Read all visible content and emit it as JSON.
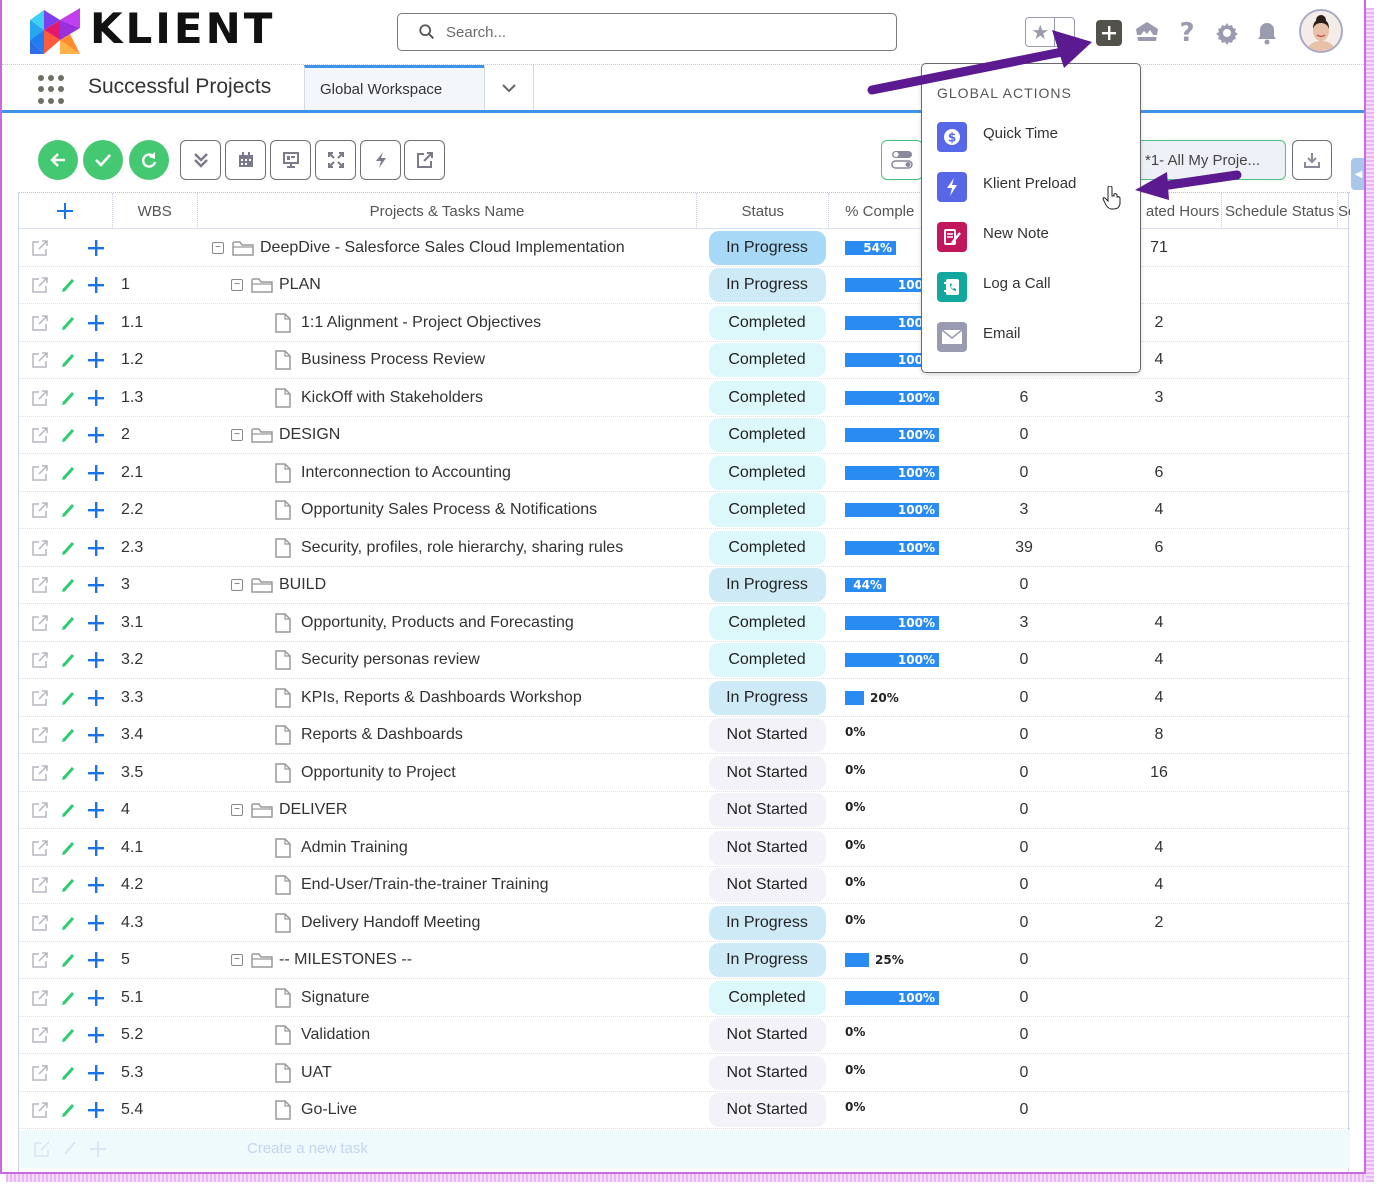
{
  "brand": {
    "name": "KLIENT"
  },
  "search": {
    "placeholder": "Search..."
  },
  "header_icons": [
    "favorites-star",
    "global-actions-plus",
    "trailhead",
    "help",
    "setup-gear",
    "notifications-bell",
    "user-avatar"
  ],
  "nav": {
    "app_name": "Successful Projects",
    "tabs": [
      {
        "label": "Global Workspace",
        "active": true
      }
    ]
  },
  "toolbar": {
    "buttons": [
      "back",
      "save",
      "refresh",
      "collapse-all",
      "calendar",
      "presentation",
      "expand-fullscreen",
      "quick-action",
      "open-external"
    ],
    "view_select": "*1- All My Proje...",
    "download": "download"
  },
  "grid": {
    "columns": [
      "",
      "WBS",
      "Projects & Tasks Name",
      "Status",
      "% Comple",
      "",
      "ated Hours",
      "Schedule Status",
      "Sc"
    ],
    "rows": [
      {
        "wbs": "",
        "name": "DeepDive - Salesforce Sales Cloud Implementation",
        "level": 0,
        "type": "folder",
        "status": "In Progress",
        "status_key": "root",
        "pct": 54,
        "actual": "",
        "est": "71",
        "editable": false
      },
      {
        "wbs": "1",
        "name": "PLAN",
        "level": 1,
        "type": "folder",
        "status": "In Progress",
        "status_key": "inprogress",
        "pct": 100,
        "actual": "",
        "est": "",
        "editable": true
      },
      {
        "wbs": "1.1",
        "name": "1:1 Alignment - Project Objectives",
        "level": 2,
        "type": "task",
        "status": "Completed",
        "status_key": "completed",
        "pct": 100,
        "actual": "",
        "est": "2",
        "editable": true
      },
      {
        "wbs": "1.2",
        "name": "Business Process Review",
        "level": 2,
        "type": "task",
        "status": "Completed",
        "status_key": "completed",
        "pct": 100,
        "actual": "",
        "est": "4",
        "editable": true
      },
      {
        "wbs": "1.3",
        "name": "KickOff with Stakeholders",
        "level": 2,
        "type": "task",
        "status": "Completed",
        "status_key": "completed",
        "pct": 100,
        "actual": "6",
        "est": "3",
        "editable": true
      },
      {
        "wbs": "2",
        "name": "DESIGN",
        "level": 1,
        "type": "folder",
        "status": "Completed",
        "status_key": "completed",
        "pct": 100,
        "actual": "0",
        "est": "",
        "editable": true
      },
      {
        "wbs": "2.1",
        "name": "Interconnection to Accounting",
        "level": 2,
        "type": "task",
        "status": "Completed",
        "status_key": "completed",
        "pct": 100,
        "actual": "0",
        "est": "6",
        "editable": true
      },
      {
        "wbs": "2.2",
        "name": "Opportunity Sales Process & Notifications",
        "level": 2,
        "type": "task",
        "status": "Completed",
        "status_key": "completed",
        "pct": 100,
        "actual": "3",
        "est": "4",
        "editable": true
      },
      {
        "wbs": "2.3",
        "name": "Security, profiles, role hierarchy, sharing rules",
        "level": 2,
        "type": "task",
        "status": "Completed",
        "status_key": "completed",
        "pct": 100,
        "actual": "39",
        "est": "6",
        "editable": true
      },
      {
        "wbs": "3",
        "name": "BUILD",
        "level": 1,
        "type": "folder",
        "status": "In Progress",
        "status_key": "inprogress",
        "pct": 44,
        "actual": "0",
        "est": "",
        "editable": true
      },
      {
        "wbs": "3.1",
        "name": "Opportunity, Products and Forecasting",
        "level": 2,
        "type": "task",
        "status": "Completed",
        "status_key": "completed",
        "pct": 100,
        "actual": "3",
        "est": "4",
        "editable": true
      },
      {
        "wbs": "3.2",
        "name": "Security personas review",
        "level": 2,
        "type": "task",
        "status": "Completed",
        "status_key": "completed",
        "pct": 100,
        "actual": "0",
        "est": "4",
        "editable": true
      },
      {
        "wbs": "3.3",
        "name": "KPIs, Reports & Dashboards Workshop",
        "level": 2,
        "type": "task",
        "status": "In Progress",
        "status_key": "inprogress",
        "pct": 20,
        "actual": "0",
        "est": "4",
        "editable": true
      },
      {
        "wbs": "3.4",
        "name": "Reports & Dashboards",
        "level": 2,
        "type": "task",
        "status": "Not Started",
        "status_key": "notstarted",
        "pct": 0,
        "actual": "0",
        "est": "8",
        "editable": true
      },
      {
        "wbs": "3.5",
        "name": "Opportunity to Project",
        "level": 2,
        "type": "task",
        "status": "Not Started",
        "status_key": "notstarted",
        "pct": 0,
        "actual": "0",
        "est": "16",
        "editable": true
      },
      {
        "wbs": "4",
        "name": "DELIVER",
        "level": 1,
        "type": "folder",
        "status": "Not Started",
        "status_key": "notstarted",
        "pct": 0,
        "actual": "0",
        "est": "",
        "editable": true
      },
      {
        "wbs": "4.1",
        "name": "Admin Training",
        "level": 2,
        "type": "task",
        "status": "Not Started",
        "status_key": "notstarted",
        "pct": 0,
        "actual": "0",
        "est": "4",
        "editable": true
      },
      {
        "wbs": "4.2",
        "name": "End-User/Train-the-trainer Training",
        "level": 2,
        "type": "task",
        "status": "Not Started",
        "status_key": "notstarted",
        "pct": 0,
        "actual": "0",
        "est": "4",
        "editable": true
      },
      {
        "wbs": "4.3",
        "name": "Delivery Handoff Meeting",
        "level": 2,
        "type": "task",
        "status": "In Progress",
        "status_key": "inprogress",
        "pct": 0,
        "actual": "0",
        "est": "2",
        "editable": true
      },
      {
        "wbs": "5",
        "name": "-- MILESTONES --",
        "level": 1,
        "type": "folder",
        "status": "In Progress",
        "status_key": "inprogress",
        "pct": 25,
        "actual": "0",
        "est": "",
        "editable": true
      },
      {
        "wbs": "5.1",
        "name": "Signature",
        "level": 2,
        "type": "task",
        "status": "Completed",
        "status_key": "completed",
        "pct": 100,
        "actual": "0",
        "est": "",
        "editable": true
      },
      {
        "wbs": "5.2",
        "name": "Validation",
        "level": 2,
        "type": "task",
        "status": "Not Started",
        "status_key": "notstarted",
        "pct": 0,
        "actual": "0",
        "est": "",
        "editable": true
      },
      {
        "wbs": "5.3",
        "name": "UAT",
        "level": 2,
        "type": "task",
        "status": "Not Started",
        "status_key": "notstarted",
        "pct": 0,
        "actual": "0",
        "est": "",
        "editable": true
      },
      {
        "wbs": "5.4",
        "name": "Go-Live",
        "level": 2,
        "type": "task",
        "status": "Not Started",
        "status_key": "notstarted",
        "pct": 0,
        "actual": "0",
        "est": "",
        "editable": true
      }
    ],
    "new_task_placeholder": "Create a new task"
  },
  "global_actions": {
    "title": "GLOBAL ACTIONS",
    "items": [
      {
        "label": "Quick Time",
        "icon": "dollar-icon",
        "color": "#5867e8"
      },
      {
        "label": "Klient Preload",
        "icon": "lightning-icon",
        "color": "#5867e8"
      },
      {
        "label": "New Note",
        "icon": "note-icon",
        "color": "#c2185b"
      },
      {
        "label": "Log a Call",
        "icon": "phone-book-icon",
        "color": "#12a89d"
      },
      {
        "label": "Email",
        "icon": "envelope-icon",
        "color": "#9a9ab0"
      }
    ]
  },
  "colors": {
    "accent": "#3b94e8",
    "success": "#45c872",
    "bar": "#2a8cf2",
    "annotation": "#5b1a8f"
  }
}
